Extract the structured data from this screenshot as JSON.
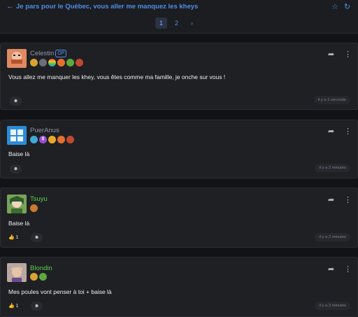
{
  "topic": {
    "back_icon": "arrow-left-icon",
    "title": "Je pars pour le Québec, vous aller me manquez les kheys",
    "star_icon": "star-icon",
    "refresh_icon": "refresh-icon"
  },
  "pagination": {
    "pages": [
      "1",
      "2"
    ],
    "next": "›",
    "current": "1"
  },
  "posts": [
    {
      "author": "Celestin",
      "author_color": "#8f97a8",
      "op_label": "OP",
      "message": "Vous allez me manquer les khey, vous êtes comme ma famille, je onche sur vous !",
      "time": "il y a 1 seconde",
      "likes": ""
    },
    {
      "author": "PuerAnus",
      "author_color": "#8f97a8",
      "message": "Baise là",
      "time": "il y a 2 minutes",
      "likes": ""
    },
    {
      "author": "Tsuyu",
      "author_color": "#5ccf4f",
      "message": "Baise là",
      "time": "il y a 2 minutes",
      "likes": "1"
    },
    {
      "author": "Blondin",
      "author_color": "#5ccf4f",
      "message": "Mes poules vont penser à toi + baise là",
      "time": "il y a 3 minutes",
      "likes": "1"
    }
  ]
}
